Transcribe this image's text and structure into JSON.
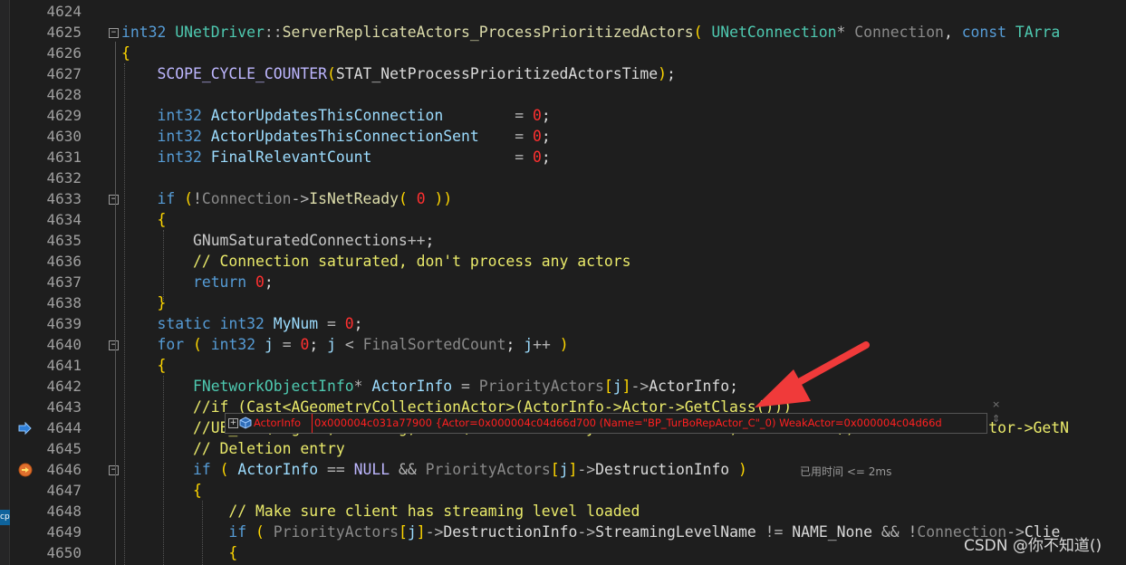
{
  "editor": {
    "lines": [
      {
        "num": "4624",
        "tokens": []
      },
      {
        "num": "4625",
        "tokens": [
          {
            "t": "int32",
            "c": "tyb"
          },
          {
            "t": " "
          },
          {
            "t": "UNetDriver",
            "c": "ty"
          },
          {
            "t": "::",
            "c": "op"
          },
          {
            "t": "ServerReplicateActors_ProcessPrioritizedActors",
            "c": "fn"
          },
          {
            "t": "( ",
            "c": "yel"
          },
          {
            "t": "UNetConnection",
            "c": "ty"
          },
          {
            "t": "* ",
            "c": "op"
          },
          {
            "t": "Connection",
            "c": "grey"
          },
          {
            "t": ", "
          },
          {
            "t": "const",
            "c": "kw"
          },
          {
            "t": " TArra",
            "c": "ty"
          }
        ]
      },
      {
        "num": "4626",
        "tokens": [
          {
            "t": "{",
            "c": "yel"
          }
        ]
      },
      {
        "num": "4627",
        "tokens": [
          {
            "t": "    "
          },
          {
            "t": "SCOPE_CYCLE_COUNTER",
            "c": "mac"
          },
          {
            "t": "(",
            "c": "yel"
          },
          {
            "t": "STAT_NetProcessPrioritizedActorsTime",
            "c": "mem"
          },
          {
            "t": ")",
            "c": "yel"
          },
          {
            "t": ";"
          }
        ]
      },
      {
        "num": "4628",
        "tokens": []
      },
      {
        "num": "4629",
        "tokens": [
          {
            "t": "    "
          },
          {
            "t": "int32",
            "c": "tyb"
          },
          {
            "t": " "
          },
          {
            "t": "ActorUpdatesThisConnection",
            "c": "var"
          },
          {
            "t": "        "
          },
          {
            "t": "= ",
            "c": "op"
          },
          {
            "t": "0",
            "c": "num"
          },
          {
            "t": ";"
          }
        ]
      },
      {
        "num": "4630",
        "tokens": [
          {
            "t": "    "
          },
          {
            "t": "int32",
            "c": "tyb"
          },
          {
            "t": " "
          },
          {
            "t": "ActorUpdatesThisConnectionSent",
            "c": "var"
          },
          {
            "t": "    "
          },
          {
            "t": "= ",
            "c": "op"
          },
          {
            "t": "0",
            "c": "num"
          },
          {
            "t": ";"
          }
        ]
      },
      {
        "num": "4631",
        "tokens": [
          {
            "t": "    "
          },
          {
            "t": "int32",
            "c": "tyb"
          },
          {
            "t": " "
          },
          {
            "t": "FinalRelevantCount",
            "c": "var"
          },
          {
            "t": "                "
          },
          {
            "t": "= ",
            "c": "op"
          },
          {
            "t": "0",
            "c": "num"
          },
          {
            "t": ";"
          }
        ]
      },
      {
        "num": "4632",
        "tokens": []
      },
      {
        "num": "4633",
        "tokens": [
          {
            "t": "    "
          },
          {
            "t": "if",
            "c": "kw"
          },
          {
            "t": " "
          },
          {
            "t": "(",
            "c": "yel"
          },
          {
            "t": "!",
            "c": "op"
          },
          {
            "t": "Connection",
            "c": "grey"
          },
          {
            "t": "->",
            "c": "op"
          },
          {
            "t": "IsNetReady",
            "c": "fn"
          },
          {
            "t": "( ",
            "c": "yel"
          },
          {
            "t": "0",
            "c": "num"
          },
          {
            "t": " ))",
            "c": "yel"
          }
        ]
      },
      {
        "num": "4634",
        "tokens": [
          {
            "t": "    "
          },
          {
            "t": "{",
            "c": "yel"
          }
        ]
      },
      {
        "num": "4635",
        "tokens": [
          {
            "t": "        "
          },
          {
            "t": "GNumSaturatedConnections",
            "c": "gv"
          },
          {
            "t": "++",
            "c": "op"
          },
          {
            "t": ";"
          }
        ]
      },
      {
        "num": "4636",
        "tokens": [
          {
            "t": "        "
          },
          {
            "t": "// Connection saturated, don't process any actors",
            "c": "cmt"
          }
        ]
      },
      {
        "num": "4637",
        "tokens": [
          {
            "t": "        "
          },
          {
            "t": "return",
            "c": "kw"
          },
          {
            "t": " "
          },
          {
            "t": "0",
            "c": "num"
          },
          {
            "t": ";"
          }
        ]
      },
      {
        "num": "4638",
        "tokens": [
          {
            "t": "    "
          },
          {
            "t": "}",
            "c": "yel"
          }
        ]
      },
      {
        "num": "4639",
        "tokens": [
          {
            "t": "    "
          },
          {
            "t": "static",
            "c": "kw"
          },
          {
            "t": " "
          },
          {
            "t": "int32",
            "c": "tyb"
          },
          {
            "t": " "
          },
          {
            "t": "MyNum",
            "c": "var"
          },
          {
            "t": " "
          },
          {
            "t": "=",
            "c": "op"
          },
          {
            "t": " "
          },
          {
            "t": "0",
            "c": "num"
          },
          {
            "t": ";"
          }
        ]
      },
      {
        "num": "4640",
        "tokens": [
          {
            "t": "    "
          },
          {
            "t": "for",
            "c": "kw"
          },
          {
            "t": " "
          },
          {
            "t": "(",
            "c": "yel"
          },
          {
            "t": " "
          },
          {
            "t": "int32",
            "c": "tyb"
          },
          {
            "t": " "
          },
          {
            "t": "j",
            "c": "var"
          },
          {
            "t": " "
          },
          {
            "t": "=",
            "c": "op"
          },
          {
            "t": " "
          },
          {
            "t": "0",
            "c": "num"
          },
          {
            "t": "; "
          },
          {
            "t": "j",
            "c": "var"
          },
          {
            "t": " "
          },
          {
            "t": "<",
            "c": "op"
          },
          {
            "t": " "
          },
          {
            "t": "FinalSortedCount",
            "c": "grey"
          },
          {
            "t": "; "
          },
          {
            "t": "j",
            "c": "var"
          },
          {
            "t": "++",
            "c": "op"
          },
          {
            "t": " )",
            "c": "yel"
          }
        ]
      },
      {
        "num": "4641",
        "tokens": [
          {
            "t": "    "
          },
          {
            "t": "{",
            "c": "yel"
          }
        ]
      },
      {
        "num": "4642",
        "tokens": [
          {
            "t": "        "
          },
          {
            "t": "FNetworkObjectInfo",
            "c": "ty"
          },
          {
            "t": "* ",
            "c": "op"
          },
          {
            "t": "ActorInfo",
            "c": "var"
          },
          {
            "t": " "
          },
          {
            "t": "=",
            "c": "op"
          },
          {
            "t": " "
          },
          {
            "t": "PriorityActors",
            "c": "grey"
          },
          {
            "t": "[",
            "c": "yel"
          },
          {
            "t": "j",
            "c": "var"
          },
          {
            "t": "]",
            "c": "yel"
          },
          {
            "t": "->",
            "c": "op"
          },
          {
            "t": "ActorInfo",
            "c": "mem"
          },
          {
            "t": ";"
          }
        ]
      },
      {
        "num": "4643",
        "tokens": [
          {
            "t": "        "
          },
          {
            "t": "//if (Cast<AGeometryCollectionActor>(ActorInfo->Actor->GetClass()))",
            "c": "cmt"
          }
        ]
      },
      {
        "num": "4644",
        "tokens": [
          {
            "t": "        "
          },
          {
            "t": "//UE_LOG(LogNet, Warning, TEXT(\"Send GeometryCollectionActor, Name = %s\"), *ActorInfo->Actor->GetN",
            "c": "cmt"
          }
        ]
      },
      {
        "num": "4645",
        "tokens": [
          {
            "t": "        "
          },
          {
            "t": "// Deletion entry",
            "c": "cmt"
          }
        ]
      },
      {
        "num": "4646",
        "tokens": [
          {
            "t": "        "
          },
          {
            "t": "if",
            "c": "kw"
          },
          {
            "t": " "
          },
          {
            "t": "(",
            "c": "yel"
          },
          {
            "t": " "
          },
          {
            "t": "ActorInfo",
            "c": "var"
          },
          {
            "t": " "
          },
          {
            "t": "==",
            "c": "op"
          },
          {
            "t": " "
          },
          {
            "t": "NULL",
            "c": "mac"
          },
          {
            "t": " "
          },
          {
            "t": "&&",
            "c": "op"
          },
          {
            "t": " "
          },
          {
            "t": "PriorityActors",
            "c": "grey"
          },
          {
            "t": "[",
            "c": "yel"
          },
          {
            "t": "j",
            "c": "var"
          },
          {
            "t": "]",
            "c": "yel"
          },
          {
            "t": "->",
            "c": "op"
          },
          {
            "t": "DestructionInfo",
            "c": "mem"
          },
          {
            "t": " )",
            "c": "yel"
          }
        ]
      },
      {
        "num": "4647",
        "tokens": [
          {
            "t": "        "
          },
          {
            "t": "{",
            "c": "yel"
          }
        ]
      },
      {
        "num": "4648",
        "tokens": [
          {
            "t": "            "
          },
          {
            "t": "// Make sure client has streaming level loaded",
            "c": "cmt"
          }
        ]
      },
      {
        "num": "4649",
        "tokens": [
          {
            "t": "            "
          },
          {
            "t": "if",
            "c": "kw"
          },
          {
            "t": " "
          },
          {
            "t": "(",
            "c": "yel"
          },
          {
            "t": " "
          },
          {
            "t": "PriorityActors",
            "c": "grey"
          },
          {
            "t": "[",
            "c": "yel"
          },
          {
            "t": "j",
            "c": "var"
          },
          {
            "t": "]",
            "c": "yel"
          },
          {
            "t": "->",
            "c": "op"
          },
          {
            "t": "DestructionInfo",
            "c": "mem"
          },
          {
            "t": "->",
            "c": "op"
          },
          {
            "t": "StreamingLevelName",
            "c": "mem"
          },
          {
            "t": " "
          },
          {
            "t": "!=",
            "c": "op"
          },
          {
            "t": " "
          },
          {
            "t": "NAME_None",
            "c": "mem"
          },
          {
            "t": " "
          },
          {
            "t": "&&",
            "c": "op"
          },
          {
            "t": " "
          },
          {
            "t": "!",
            "c": "op"
          },
          {
            "t": "Connection",
            "c": "grey"
          },
          {
            "t": "->",
            "c": "op"
          },
          {
            "t": "Clie",
            "c": "mem"
          }
        ]
      },
      {
        "num": "4650",
        "tokens": [
          {
            "t": "            "
          },
          {
            "t": "{",
            "c": "yel"
          }
        ]
      }
    ]
  },
  "datatip": {
    "name": "ActorInfo",
    "value": "0x000004c031a77900 {Actor=0x000004c04d66d700 (Name=\"BP_TurBoRepActor_C\"_0) WeakActor=0x000004c04d66d",
    "expand_glyph": "+",
    "close_glyph": "×",
    "pin_glyph": "⇕"
  },
  "perf_tip": "已用时间 <= 2ms",
  "left_tab_label": "cp",
  "watermark": "CSDN @你不知道()",
  "colors": {
    "background": "#1e1e1e",
    "arrow": "#f03a3a",
    "breakpoint": "#e0702f"
  }
}
